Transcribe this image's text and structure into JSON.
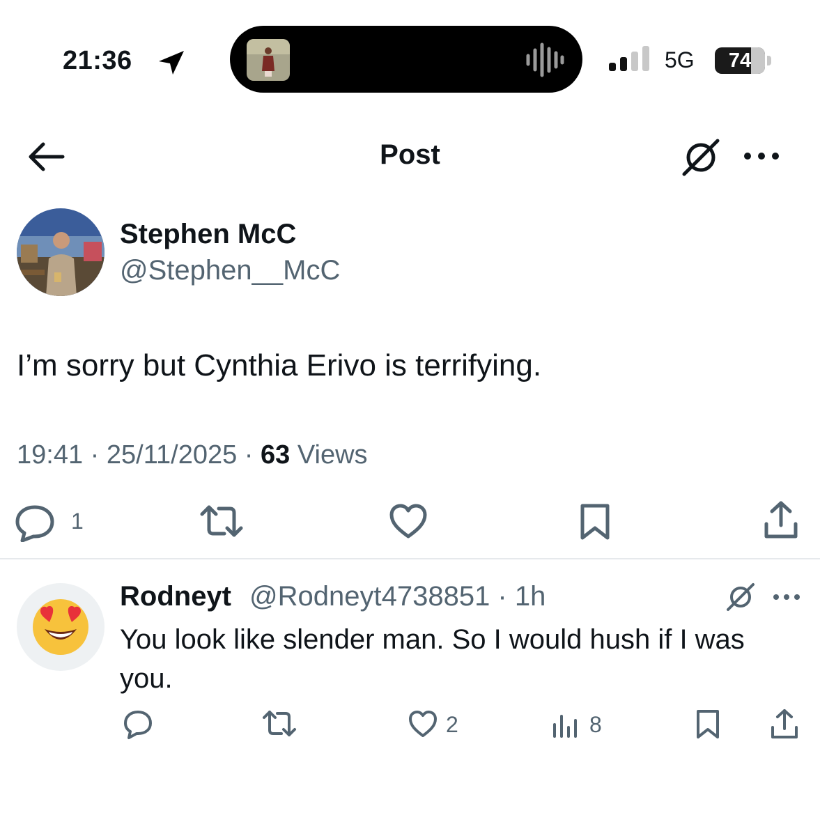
{
  "status_bar": {
    "time": "21:36",
    "network": "5G",
    "battery": "74"
  },
  "header": {
    "title": "Post",
    "back_icon": "arrow-left-icon",
    "grok_icon": "grok-icon",
    "more_icon": "more-horizontal-icon"
  },
  "post": {
    "author_name": "Stephen McC",
    "author_handle": "@Stephen__McC",
    "text": "I’m sorry but Cynthia Erivo is terrifying.",
    "time": "19:41",
    "date": "25/11/2025",
    "views_count": "63",
    "views_label": "Views",
    "reply_count": "1"
  },
  "reply": {
    "author_name": "Rodneyt",
    "author_handle": "@Rodneyt4738851",
    "age": "1h",
    "text": "You look like slender man. So I would hush if I was you.",
    "like_count": "2",
    "views_count": "8"
  },
  "colors": {
    "text_primary": "#0f1419",
    "text_secondary": "#536471",
    "divider": "#e6e9ec"
  }
}
